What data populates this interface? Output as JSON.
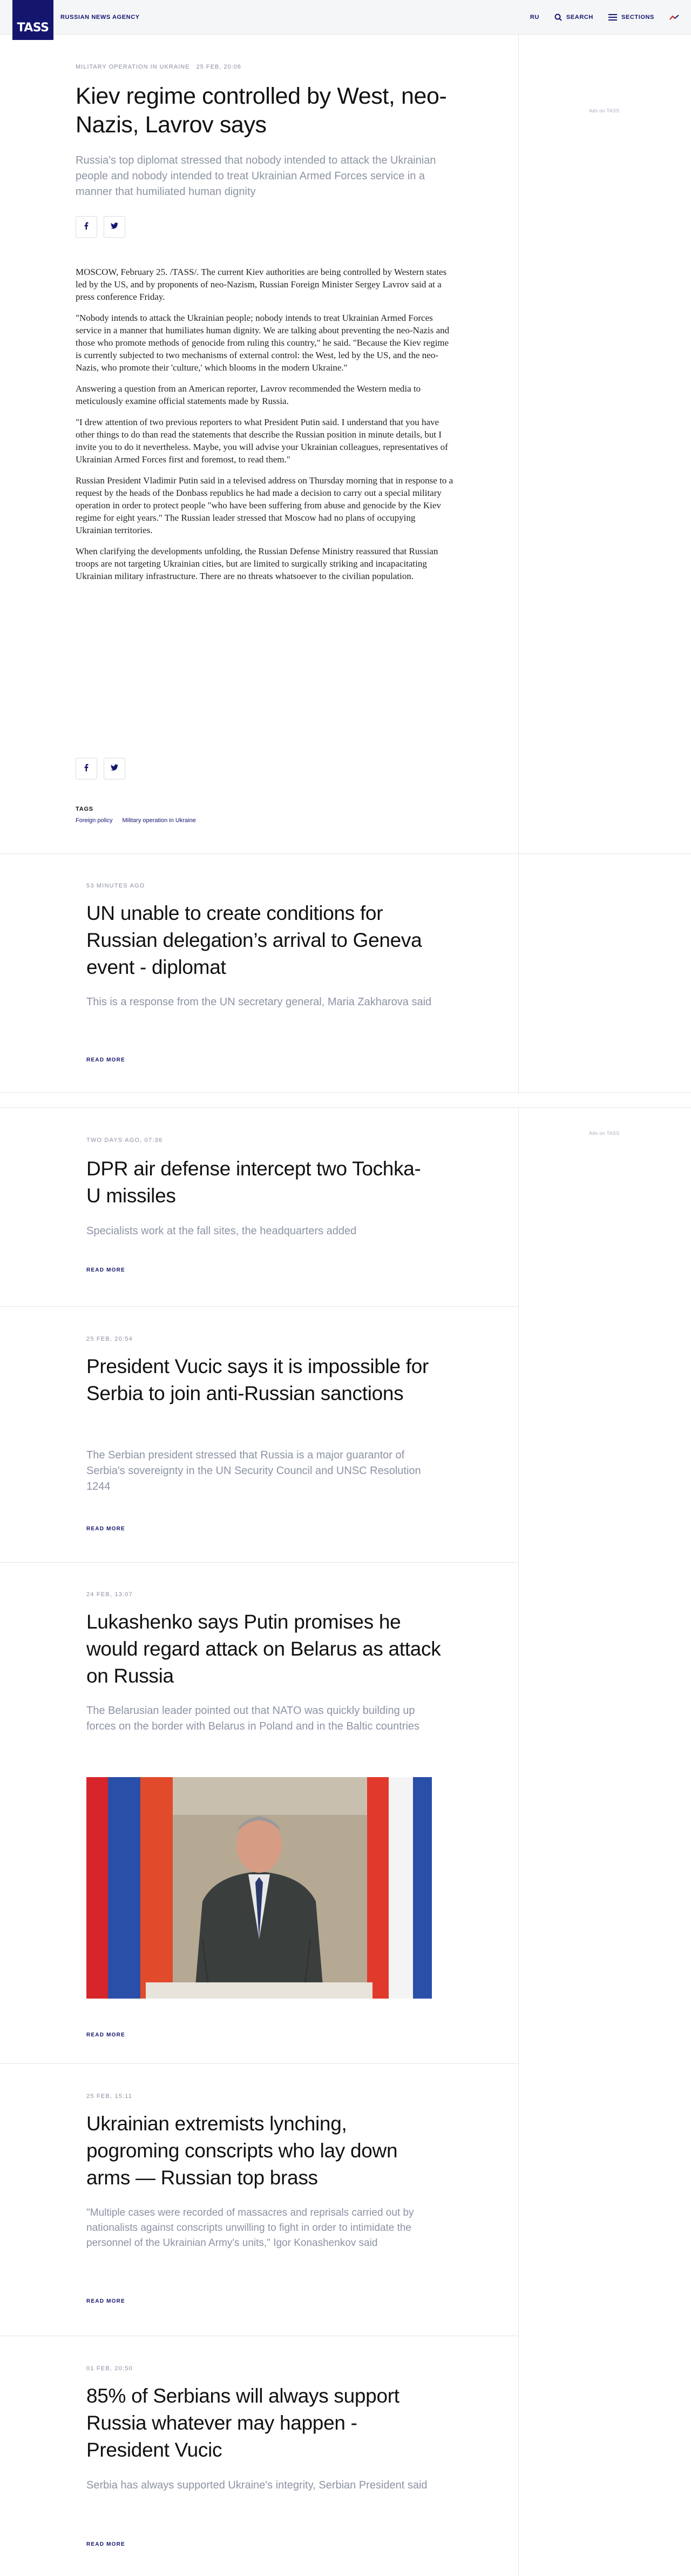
{
  "header": {
    "logo": "TASS",
    "agency_name": "RUSSIAN NEWS AGENCY",
    "lang": "RU",
    "search_label": "SEARCH",
    "sections_label": "SECTIONS"
  },
  "ads": {
    "label_1": "Ads on TASS",
    "label_2": "Ads on TASS"
  },
  "article": {
    "category": "MILITARY OPERATION IN UKRAINE",
    "date": "25 FEB, 20:06",
    "title": "Kiev regime controlled by West, neo-Nazis, Lavrov says",
    "lead": "Russia's top diplomat stressed that nobody intended to attack the Ukrainian people and nobody intended to treat Ukrainian Armed Forces service in a manner that humiliated human dignity",
    "paragraphs": [
      "MOSCOW, February 25. /TASS/. The current Kiev authorities are being controlled by Western states led by the US, and by proponents of neo-Nazism, Russian Foreign Minister Sergey Lavrov said at a press conference Friday.",
      "\"Nobody intends to attack the Ukrainian people; nobody intends to treat Ukrainian Armed Forces service in a manner that humiliates human dignity. We are talking about preventing the neo-Nazis and those who promote methods of genocide from ruling this country,\" he said. \"Because the Kiev regime is currently subjected to two mechanisms of external control: the West, led by the US, and the neo-Nazis, who promote their 'culture,' which blooms in the modern Ukraine.\"",
      "Answering a question from an American reporter, Lavrov recommended the Western media to meticulously examine official statements made by Russia.",
      "\"I drew attention of two previous reporters to what President Putin said. I understand that you have other things to do than read the statements that describe the Russian position in minute details, but I invite you to do it nevertheless. Maybe, you will advise your Ukrainian colleagues, representatives of Ukrainian Armed Forces first and foremost, to read them.\"",
      "Russian President Vladimir Putin said in a televised address on Thursday morning that in response to a request by the heads of the Donbass republics he had made a decision to carry out a special military operation in order to protect people \"who have been suffering from abuse and genocide by the Kiev regime for eight years.\" The Russian leader stressed that Moscow had no plans of occupying Ukrainian territories.",
      "When clarifying the developments unfolding, the Russian Defense Ministry reassured that Russian troops are not targeting Ukrainian cities, but are limited to surgically striking and incapacitating Ukrainian military infrastructure. There are no threats whatsoever to the civilian population."
    ],
    "tags_title": "TAGS",
    "tags": [
      "Foreign policy",
      "Military operation in Ukraine"
    ]
  },
  "news": [
    {
      "date": "53 MINUTES AGO",
      "title": "UN unable to create conditions for Russian delegation’s arrival to Geneva event - diplomat",
      "lead": "This is a response from the UN secretary general, Maria Zakharova said",
      "read_more": "READ MORE"
    },
    {
      "date": "TWO DAYS AGO, 07:36",
      "title": "DPR air defense intercept two Tochka-U missiles",
      "lead": "Specialists work at the fall sites, the headquarters added",
      "read_more": "READ MORE"
    },
    {
      "date": "25 FEB, 20:54",
      "title": "President Vucic says it is impossible for Serbia to join anti-Russian sanctions",
      "lead": "The Serbian president stressed that Russia is a major guarantor of Serbia's sovereignty in the UN Security Council and UNSC Resolution 1244",
      "read_more": "READ MORE"
    },
    {
      "date": "24 FEB, 13:07",
      "title": "Lukashenko says Putin promises he would regard attack on Belarus as attack on Russia",
      "lead": "The Belarusian leader pointed out that NATO was quickly building up forces on the border with Belarus in Poland and in the Baltic countries",
      "read_more": "READ MORE"
    },
    {
      "date": "25 FEB, 15:11",
      "title": "Ukrainian extremists lynching, pogroming conscripts who lay down arms — Russian top brass",
      "lead": "\"Multiple cases were recorded of massacres and reprisals carried out by nationalists against conscripts unwilling to fight in order to intimidate the personnel of the Ukrainian Army's units,\" Igor Konashenkov said",
      "read_more": "READ MORE"
    },
    {
      "date": "01 FEB, 20:50",
      "title": "85% of Serbians will always support Russia whatever may happen - President Vucic",
      "lead": "Serbia has always supported Ukraine's integrity, Serbian President said",
      "read_more": "READ MORE"
    }
  ],
  "colors": {
    "brand": "#14166e",
    "muted": "#8d93a5",
    "divider": "#e3e5ea"
  }
}
